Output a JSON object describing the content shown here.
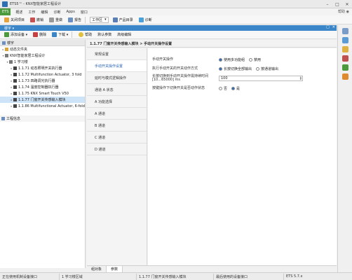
{
  "titlebar": {
    "title": "ETS5™ - KNX智能家居工程设计"
  },
  "menubar": {
    "mode": "ETS",
    "items": [
      "概述",
      "工作",
      "编辑",
      "诊断",
      "Apps",
      "窗口"
    ],
    "right": "帮助 ◉"
  },
  "toolbar": {
    "items": [
      "关闭项目",
      "撤销",
      "重做",
      "报告",
      "工作区"
    ],
    "workspace_dropdown": "工作区",
    "catalog": "产品目录",
    "diagnostics": "诊断"
  },
  "projbar": {
    "label": "楼宇 ▾"
  },
  "panelbar": {
    "left_items": [
      "添加设备 ▾",
      "删除",
      "下载 ▾"
    ],
    "right_items": [
      "帮助",
      "默认参数",
      "高级编辑"
    ]
  },
  "tree": {
    "header": "楼宇",
    "nodes": [
      {
        "label": "动态文件夹",
        "level": 1,
        "color": "#d8a43a",
        "expanded": false
      },
      {
        "label": "KNX智能家居工程设计",
        "level": 1,
        "color": "#7a7a7a",
        "expanded": true
      },
      {
        "label": "1 学习楼",
        "level": 2,
        "color": "#777777",
        "expanded": true
      },
      {
        "label": "1.1.71 动态照明开关执行器",
        "level": 3,
        "color": "#444444",
        "expanded": false
      },
      {
        "label": "1.1.72 Multifunction Actuator, 3 fold",
        "level": 3,
        "color": "#444444",
        "expanded": false
      },
      {
        "label": "1.1.73 四路调光执行器",
        "level": 3,
        "color": "#444444",
        "expanded": false
      },
      {
        "label": "1.1.74 温度控制器执行器",
        "level": 3,
        "color": "#444444",
        "expanded": false
      },
      {
        "label": "1.1.75 KNX Smart Touch V50",
        "level": 3,
        "color": "#444444",
        "expanded": false
      },
      {
        "label": "1.1.77 门窗开关传感输入模块",
        "level": 3,
        "color": "#444444",
        "expanded": false,
        "selected": true
      },
      {
        "label": "1.1.86 Multifunctional Actuator, 6-fold",
        "level": 3,
        "color": "#444444",
        "expanded": false
      }
    ],
    "footer": "工程信息"
  },
  "main": {
    "header": "1.1.77 门窗开关传感输入模块 > 手动开关操作设置",
    "categories": [
      "常规设置",
      "手动开关操作设置",
      "延时与模式逻辑操作",
      "通道 A 状态",
      "A 功能选择",
      "A 通道",
      "B 通道",
      "C 通道",
      "D 通道"
    ],
    "selected_category": 1,
    "fields": [
      {
        "label": "手动开关操作",
        "type": "radio",
        "options": [
          "使用多功能组",
          "禁用"
        ],
        "selected": 0
      },
      {
        "label": "执行手动开关的开关动作方式",
        "type": "radio",
        "options": [
          "长按切换全部输出",
          "按通道输出"
        ],
        "selected": 0
      },
      {
        "label": "长按切换到手动开关操作需持续时间 [10...65000] ms",
        "type": "number",
        "value": "100"
      },
      {
        "label": "按键操作下切换开关是否动作状态",
        "type": "radio",
        "options": [
          "否",
          "是"
        ],
        "selected": 1
      }
    ]
  },
  "bottomtabs": [
    "组对象",
    "参数"
  ],
  "statusbar": [
    "正在使用机制设备接口",
    "1 学习楼区域",
    "1.1.77 门窗开关传感输入模块",
    "最后使用的设备接口",
    "ETS 5.7.x"
  ],
  "colors": {
    "accent": "#3a86c8",
    "selection": "#cde3f7",
    "mode": "#4b9a3c"
  }
}
